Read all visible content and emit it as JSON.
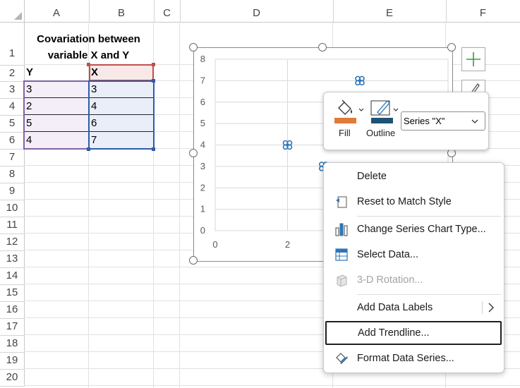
{
  "sheet": {
    "columns": [
      "A",
      "B",
      "C",
      "D",
      "E",
      "F"
    ],
    "rows": [
      "1",
      "2",
      "3",
      "4",
      "5",
      "6",
      "7",
      "8",
      "9",
      "10",
      "11",
      "12",
      "13",
      "14",
      "15",
      "16",
      "17",
      "18",
      "19",
      "20"
    ],
    "title_line1": "Covariation between",
    "title_line2": "variable X and Y",
    "header_y": "Y",
    "header_x": "X",
    "y_values": [
      "3",
      "2",
      "5",
      "4"
    ],
    "x_values": [
      "3",
      "4",
      "6",
      "7"
    ]
  },
  "chart_data": {
    "type": "scatter",
    "series": [
      {
        "name": "X",
        "x": [
          2,
          4,
          6,
          7
        ],
        "y": [
          3,
          4,
          6,
          7
        ]
      }
    ],
    "y_ticks": [
      "0",
      "1",
      "2",
      "3",
      "4",
      "5",
      "6",
      "7",
      "8"
    ],
    "x_ticks_visible": [
      "0",
      "2"
    ],
    "ylim": [
      0,
      8
    ],
    "xlim": [
      0,
      8
    ],
    "visible_points": [
      {
        "x": 2,
        "y": 4
      },
      {
        "x": 3,
        "y": 3
      },
      {
        "x": 4,
        "y": 7
      }
    ],
    "grid": true,
    "marker_color": "#2e75b6"
  },
  "format_popup": {
    "fill_label": "Fill",
    "outline_label": "Outline",
    "series_value": "Series \"X\"",
    "fill_color": "#e07b39",
    "outline_color": "#1f5373"
  },
  "context_menu": {
    "items": [
      {
        "label": "Delete",
        "icon": "none",
        "enabled": true
      },
      {
        "label": "Reset to Match Style",
        "icon": "reset-style-icon",
        "enabled": true
      },
      {
        "label": "Change Series Chart Type...",
        "icon": "chart-type-icon",
        "enabled": true
      },
      {
        "label": "Select Data...",
        "icon": "select-data-icon",
        "enabled": true
      },
      {
        "label": "3-D Rotation...",
        "icon": "rotation-3d-icon",
        "enabled": false
      },
      {
        "label": "Add Data Labels",
        "icon": "none",
        "enabled": true
      },
      {
        "label": "Add Trendline...",
        "icon": "none",
        "enabled": true
      },
      {
        "label": "Format Data Series...",
        "icon": "format-series-icon",
        "enabled": true
      }
    ]
  }
}
